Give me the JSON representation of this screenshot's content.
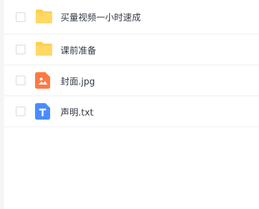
{
  "files": [
    {
      "name": "买量视频一小时速成",
      "icon": "folder-icon",
      "type": "folder",
      "color": "#FFD15C"
    },
    {
      "name": "课前准备",
      "icon": "folder-icon",
      "type": "folder",
      "color": "#FFD15C"
    },
    {
      "name": "封面.jpg",
      "icon": "image-file-icon",
      "type": "image",
      "color": "#FF7A45"
    },
    {
      "name": "声明.txt",
      "icon": "text-file-icon",
      "type": "text",
      "color": "#4A8CFF"
    }
  ]
}
